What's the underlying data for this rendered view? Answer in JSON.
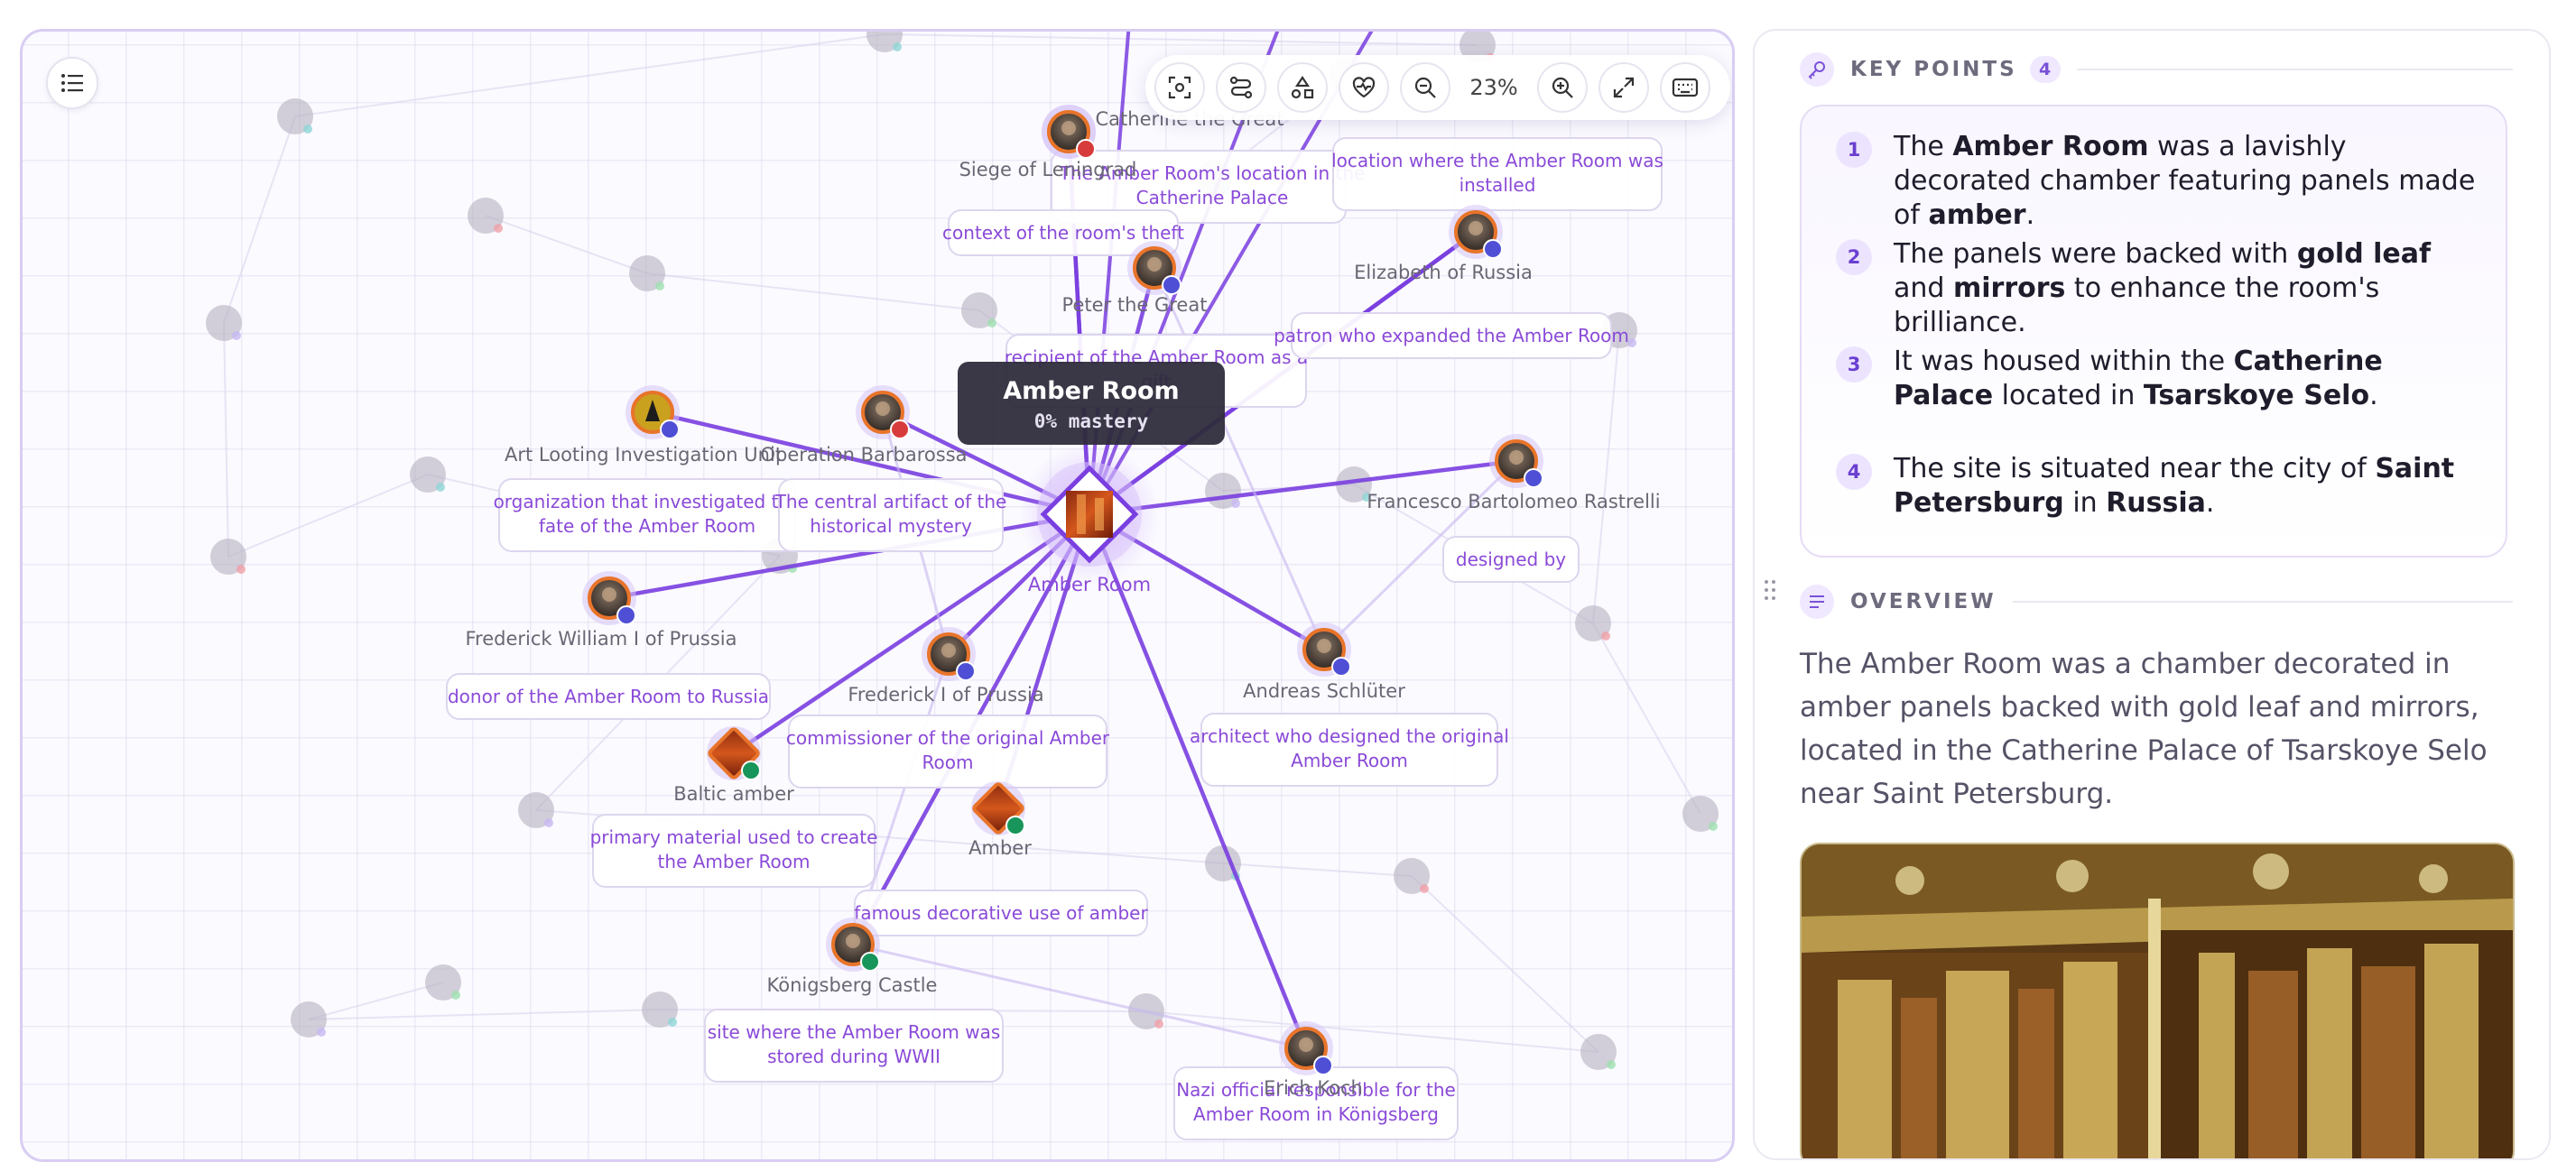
{
  "toolbar": {
    "zoom": "23%"
  },
  "tooltip": {
    "title": "Amber Room",
    "subtitle": "0% mastery"
  },
  "graph": {
    "nodes": [
      {
        "id": "amber-room",
        "label": "Amber Room",
        "image": "amber-room"
      },
      {
        "id": "catherine-the-great",
        "label": "Catherine the Great",
        "image": "portrait"
      },
      {
        "id": "siege-of-leningrad",
        "label": "Siege of Leningrad",
        "image": "event"
      },
      {
        "id": "peter-the-great",
        "label": "Peter the Great",
        "image": "portrait"
      },
      {
        "id": "elizabeth-of-russia",
        "label": "Elizabeth of Russia",
        "image": "portrait"
      },
      {
        "id": "art-looting-unit",
        "label": "Art Looting Investigation Unit",
        "image": "emblem"
      },
      {
        "id": "operation-barbarossa",
        "label": "Operation Barbarossa",
        "image": "event"
      },
      {
        "id": "rastrelli",
        "label": "Francesco Bartolomeo Rastrelli",
        "image": "portrait"
      },
      {
        "id": "frederick-william-i",
        "label": "Frederick William I of Prussia",
        "image": "portrait"
      },
      {
        "id": "frederick-i",
        "label": "Frederick I of Prussia",
        "image": "portrait"
      },
      {
        "id": "andreas-schluter",
        "label": "Andreas Schlüter",
        "image": "portrait"
      },
      {
        "id": "baltic-amber",
        "label": "Baltic amber",
        "image": "material"
      },
      {
        "id": "amber",
        "label": "Amber",
        "image": "material"
      },
      {
        "id": "konigsberg-castle",
        "label": "Königsberg Castle",
        "image": "building"
      },
      {
        "id": "erich-koch",
        "label": "Erich Koch",
        "image": "portrait"
      }
    ],
    "edges": [
      {
        "target": "catherine-the-great",
        "label": "The Amber Room's location in the Catherine Palace"
      },
      {
        "target": "elizabeth-of-russia",
        "label": "location where the Amber Room was installed"
      },
      {
        "target": "siege-of-leningrad",
        "label": "context of the room's theft"
      },
      {
        "target": "peter-the-great",
        "label": "recipient of the Amber Room as a gift"
      },
      {
        "target": "elizabeth-of-russia",
        "label": "patron who expanded the Amber Room"
      },
      {
        "target": "art-looting-unit",
        "label": "organization that investigated the fate of the Amber Room"
      },
      {
        "target": "operation-barbarossa",
        "label": "The central artifact of the historical mystery"
      },
      {
        "target": "rastrelli",
        "label": "designed by"
      },
      {
        "target": "frederick-william-i",
        "label": "donor of the Amber Room to Russia"
      },
      {
        "target": "frederick-i",
        "label": "commissioner of the original Amber Room"
      },
      {
        "target": "andreas-schluter",
        "label": "architect who designed the original Amber Room"
      },
      {
        "target": "baltic-amber",
        "label": "primary material used to create the Amber Room"
      },
      {
        "target": "amber",
        "label": "famous decorative use of amber"
      },
      {
        "target": "konigsberg-castle",
        "label": "site where the Amber Room was stored during WWII"
      },
      {
        "target": "erich-koch",
        "label": "Nazi official responsible for the Amber Room in Königsberg"
      }
    ]
  },
  "right_panel": {
    "key_points": {
      "title": "KEY POINTS",
      "count": "4",
      "items": [
        {
          "num": "1",
          "parts": [
            {
              "t": "The "
            },
            {
              "t": "Amber Room",
              "b": true
            },
            {
              "t": " was a lavishly decorated chamber featuring panels made of "
            },
            {
              "t": "amber",
              "b": true
            },
            {
              "t": "."
            }
          ]
        },
        {
          "num": "2",
          "parts": [
            {
              "t": "The panels were backed with "
            },
            {
              "t": "gold leaf",
              "b": true
            },
            {
              "t": " and "
            },
            {
              "t": "mirrors",
              "b": true
            },
            {
              "t": " to enhance the room's brilliance."
            }
          ]
        },
        {
          "num": "3",
          "parts": [
            {
              "t": "It was housed within the "
            },
            {
              "t": "Catherine Palace",
              "b": true
            },
            {
              "t": " located in "
            },
            {
              "t": "Tsarskoye Selo",
              "b": true
            },
            {
              "t": "."
            }
          ]
        },
        {
          "num": "4",
          "parts": [
            {
              "t": "The site is situated near the city of "
            },
            {
              "t": "Saint Petersburg",
              "b": true
            },
            {
              "t": " in "
            },
            {
              "t": "Russia",
              "b": true
            },
            {
              "t": "."
            }
          ]
        }
      ]
    },
    "overview": {
      "title": "OVERVIEW",
      "text": "The Amber Room was a chamber decorated in amber panels backed with gold leaf and mirrors, located in the Catherine Palace of Tsarskoye Selo near Saint Petersburg."
    }
  },
  "colors": {
    "accent": "#7a3fe0",
    "label_text": "#8a4ad8",
    "node_ring": "#e8742a",
    "badge_blue": "#4f4fd6",
    "badge_green": "#18955a"
  }
}
